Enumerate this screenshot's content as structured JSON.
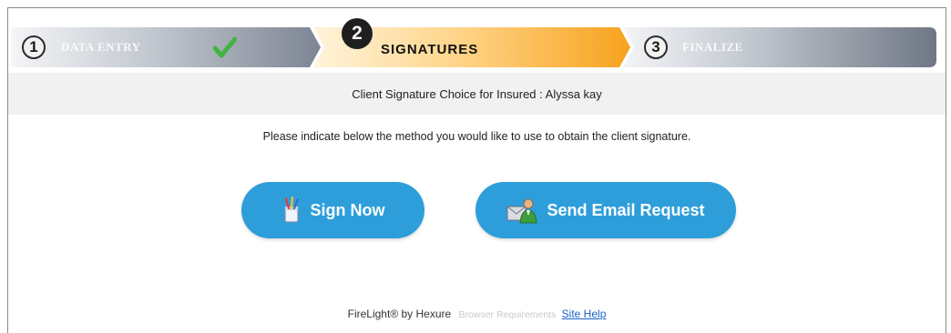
{
  "steps": [
    {
      "number": "1",
      "label": "DATA ENTRY",
      "state": "complete"
    },
    {
      "number": "2",
      "label": "SIGNATURES",
      "state": "active"
    },
    {
      "number": "3",
      "label": "FINALIZE",
      "state": "pending"
    }
  ],
  "subtitle": "Client Signature Choice for Insured : Alyssa kay",
  "instruction": "Please indicate below the method you would like to use to obtain the client signature.",
  "buttons": {
    "sign_now": "Sign Now",
    "send_email": "Send Email Request"
  },
  "footer": {
    "brand": "FireLight® by Hexure",
    "browser_requirements": "Browser Requirements",
    "site_help": "Site Help"
  },
  "icons": {
    "complete": "checkmark-icon",
    "sign_now": "pen-cup-icon",
    "send_email": "person-email-icon"
  },
  "colors": {
    "button": "#2e9edb",
    "active_step": "#f9a826",
    "pending_step": "#8f97a4",
    "check": "#3fb53f",
    "link": "#1a5fc8"
  }
}
